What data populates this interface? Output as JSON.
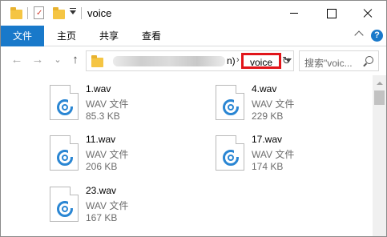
{
  "window": {
    "title": "voice"
  },
  "ribbon": {
    "tabs": [
      "文件",
      "主页",
      "共享",
      "查看"
    ],
    "help": "?"
  },
  "nav": {
    "back": "←",
    "forward": "→",
    "recent": "⌄",
    "up": "↑",
    "path_tail_paren": "n)",
    "separator": "›",
    "current_folder": "voice",
    "refresh": "↻",
    "search_placeholder": "搜索\"voic..."
  },
  "files": [
    {
      "name": "1.wav",
      "type": "WAV 文件",
      "size": "85.3 KB"
    },
    {
      "name": "4.wav",
      "type": "WAV 文件",
      "size": "229 KB"
    },
    {
      "name": "11.wav",
      "type": "WAV 文件",
      "size": "206 KB"
    },
    {
      "name": "17.wav",
      "type": "WAV 文件",
      "size": "174 KB"
    },
    {
      "name": "23.wav",
      "type": "WAV 文件",
      "size": "167 KB"
    }
  ],
  "colors": {
    "accent": "#1979ca",
    "highlight": "#e1151a",
    "icon_blue": "#2a86d3",
    "folder": "#f5c543"
  },
  "icons": [
    "folder-icon",
    "properties-icon",
    "wav-file-icon",
    "search-icon",
    "help-icon"
  ]
}
